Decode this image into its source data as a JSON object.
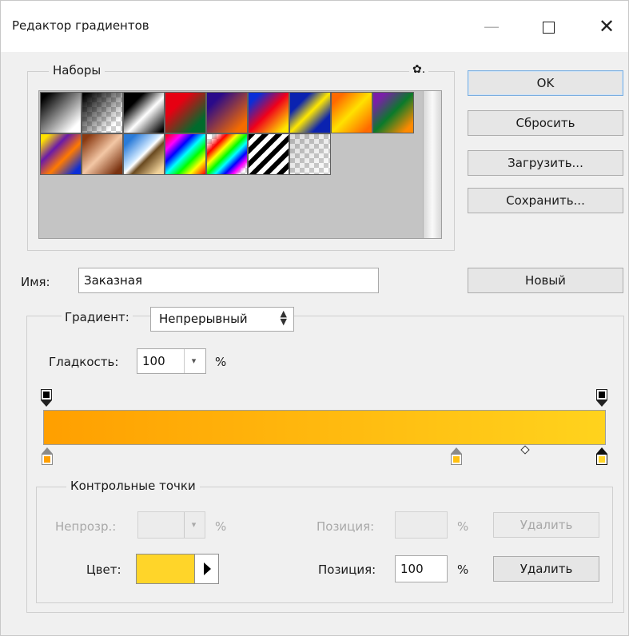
{
  "window": {
    "title": "Редактор градиентов",
    "minimize_glyph": "—",
    "close_glyph": "✕"
  },
  "presets": {
    "legend": "Наборы",
    "menu_icon": "gear-icon",
    "menu_glyph": "✿.",
    "swatches": [
      "black-to-white",
      "black-to-transparent",
      "black-white-black",
      "red-to-green",
      "violet-to-orange",
      "blue-red-yellow",
      "blue-yellow-blue",
      "orange-yellow-orange",
      "violet-green-orange",
      "yellow-violet-orange-blue",
      "copper",
      "chrome",
      "spectrum",
      "transparent-rainbow",
      "transparent-stripes",
      "neutral-density"
    ]
  },
  "buttons": {
    "ok": "OK",
    "reset": "Сбросить",
    "load": "Загрузить...",
    "save": "Сохранить...",
    "new": "Новый"
  },
  "name": {
    "label": "Имя:",
    "value": "Заказная"
  },
  "gradient": {
    "type_label": "Градиент:",
    "type_value": "Непрерывный",
    "smoothness_label": "Гладкость:",
    "smoothness_value": "100",
    "smoothness_unit": "%",
    "start_color": "#ff9f00",
    "end_color": "#ffd31d"
  },
  "stops": {
    "legend": "Контрольные точки",
    "opacity_label": "Непрозр.:",
    "opacity_unit": "%",
    "opacity_position_label": "Позиция:",
    "opacity_position_unit": "%",
    "opacity_delete": "Удалить",
    "color_label": "Цвет:",
    "color_value": "#ffd529",
    "color_position_label": "Позиция:",
    "color_position_value": "100",
    "color_position_unit": "%",
    "color_delete": "Удалить"
  }
}
